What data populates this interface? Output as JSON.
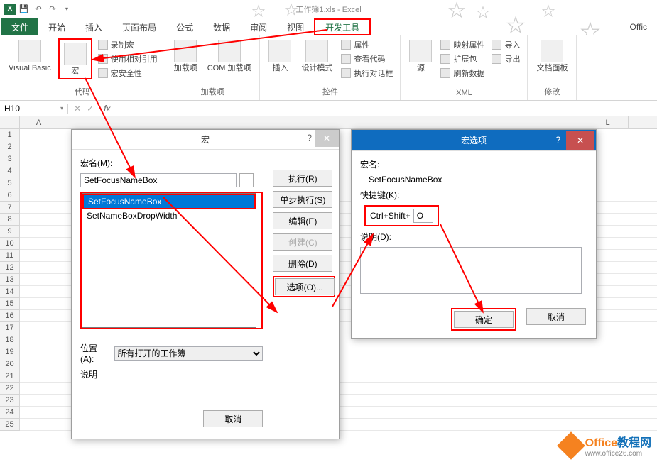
{
  "titlebar": {
    "title": "工作簿1.xls - Excel"
  },
  "qat": {
    "excel_icon": "X",
    "save_icon": "💾",
    "undo_icon": "↶",
    "redo_icon": "↷"
  },
  "tabs": {
    "file": "文件",
    "home": "开始",
    "insert": "插入",
    "layout": "页面布局",
    "formulas": "公式",
    "data": "数据",
    "review": "审阅",
    "view": "视图",
    "developer": "开发工具",
    "office": "Offic"
  },
  "ribbon": {
    "code": {
      "visual_basic": "Visual Basic",
      "macros": "宏",
      "record_macro": "录制宏",
      "relative_ref": "使用相对引用",
      "macro_security": "宏安全性",
      "label": "代码"
    },
    "addins": {
      "addins": "加载项",
      "com_addins": "COM 加载项",
      "label": "加载项"
    },
    "controls": {
      "insert": "插入",
      "design_mode": "设计模式",
      "properties": "属性",
      "view_code": "查看代码",
      "run_dialog": "执行对话框",
      "label": "控件"
    },
    "xml": {
      "source": "源",
      "map_properties": "映射属性",
      "expansion_pack": "扩展包",
      "refresh_data": "刷新数据",
      "import": "导入",
      "export": "导出",
      "label": "XML"
    },
    "modify": {
      "doc_panel": "文档面板",
      "label": "修改"
    }
  },
  "namebox": {
    "value": "H10"
  },
  "columns": [
    "A",
    "L"
  ],
  "rows_count": 25,
  "macro_dialog": {
    "title": "宏",
    "help": "?",
    "name_label": "宏名(M):",
    "name_value": "SetFocusNameBox",
    "list": [
      "SetFocusNameBox",
      "SetNameBoxDropWidth"
    ],
    "location_label": "位置(A):",
    "location_value": "所有打开的工作簿",
    "desc_label": "说明",
    "buttons": {
      "run": "执行(R)",
      "step": "单步执行(S)",
      "edit": "编辑(E)",
      "create": "创建(C)",
      "delete": "删除(D)",
      "options": "选项(O)...",
      "cancel": "取消"
    }
  },
  "options_dialog": {
    "title": "宏选项",
    "help": "?",
    "macro_name_label": "宏名:",
    "macro_name": "SetFocusNameBox",
    "shortcut_label": "快捷键(K):",
    "shortcut_prefix": "Ctrl+Shift+",
    "shortcut_key": "O",
    "desc_label": "说明(D):",
    "ok": "确定",
    "cancel": "取消"
  },
  "watermark": {
    "t1": "Office",
    "t2": "教程网",
    "url": "www.office26.com"
  }
}
